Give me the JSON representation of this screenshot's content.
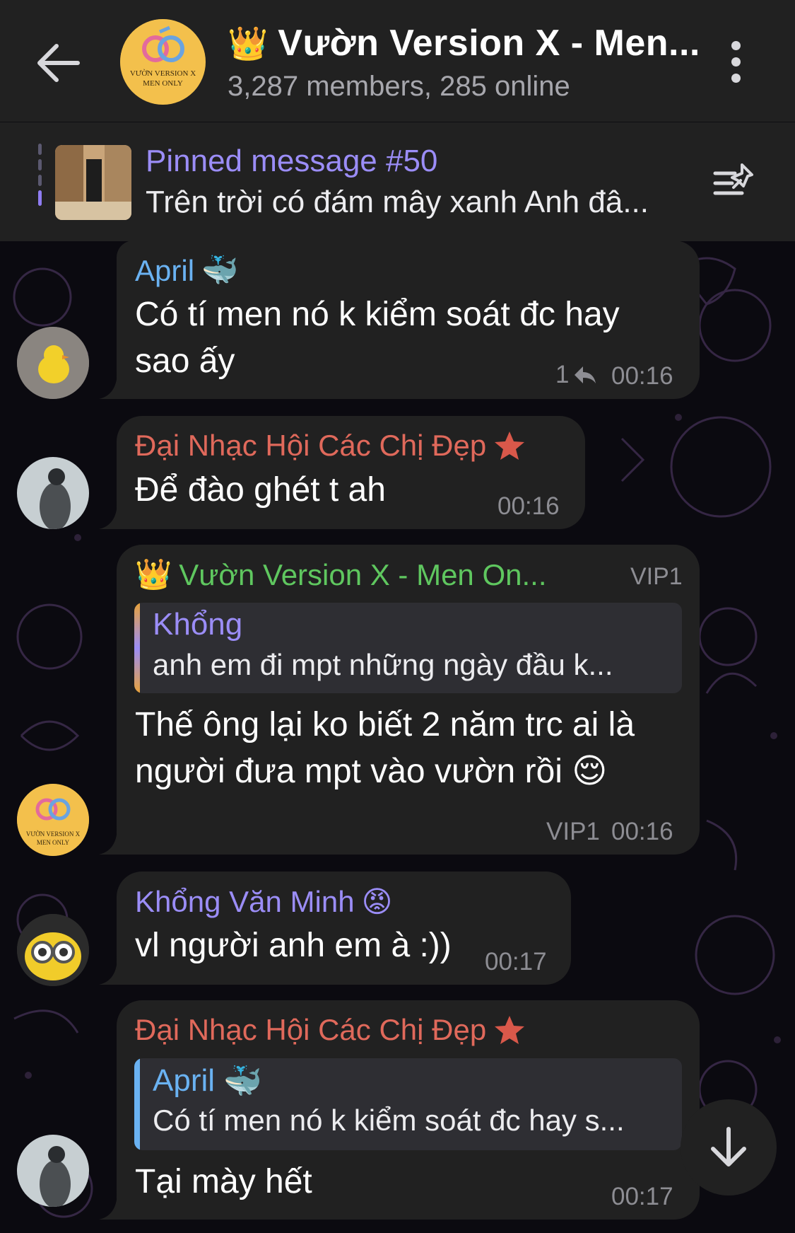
{
  "header": {
    "title": "Vườn Version X - Men...",
    "subtitle": "3,287 members, 285 online",
    "avatar_text_line1": "VƯỜN VERSION X",
    "avatar_text_line2": "MEN ONLY",
    "crown_icon": "crown-icon"
  },
  "pinned": {
    "title": "Pinned message #50",
    "text": "Trên trời có đám mây xanh Anh đâ..."
  },
  "messages": [
    {
      "sender": "April",
      "sender_color": "#6ab2f2",
      "badge": "whale-emoji",
      "text_line1": "Có tí men nó k kiểm soát đc hay",
      "text_line2": "sao ấy",
      "reply_count": "1",
      "time": "00:16"
    },
    {
      "sender": "Đại Nhạc Hội Các Chị Đẹp",
      "sender_color": "#e0695b",
      "badge": "star-icon",
      "text_line1": "Để đào ghét t ah",
      "time": "00:16"
    },
    {
      "sender": "Vườn Version X - Men On...",
      "sender_color": "#5fc75f",
      "badge": "crown-emoji",
      "rank": "VIP1",
      "reply_to_name": "Khổng",
      "reply_to_text": "anh em đi mpt những ngày đầu k...",
      "text_line1": "Thế ông lại ko biết 2 năm trc ai là",
      "text_line2": "người đưa mpt vào vườn rồi",
      "emoji": "😌",
      "rank_footer": "VIP1",
      "time": "00:16"
    },
    {
      "sender": "Khổng Văn Minh",
      "sender_color": "#9b8df7",
      "badge": "angry-keyboard-emoji",
      "text_line1": "vl người anh em à :))",
      "time": "00:17"
    },
    {
      "sender": "Đại Nhạc Hội Các Chị Đẹp",
      "sender_color": "#e0695b",
      "badge": "star-icon",
      "reply_to_name": "April",
      "reply_to_text": "Có tí men nó k kiểm soát đc hay s...",
      "text_line1": "Tại mày hết",
      "time": "00:17"
    }
  ],
  "colors": {
    "bubble": "#212121",
    "background": "#0b0a10",
    "accent_purple": "#9b8df7"
  }
}
